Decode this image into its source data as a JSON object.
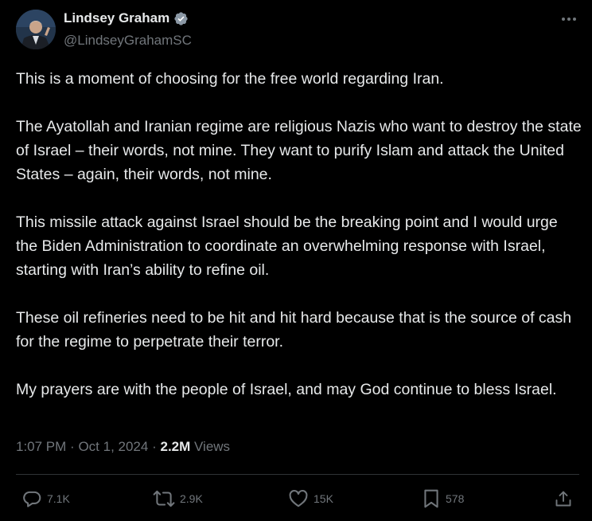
{
  "author": {
    "name": "Lindsey Graham",
    "handle": "@LindseyGrahamSC",
    "verified_icon": "verified-badge-icon",
    "badge_color": "#8b98a5"
  },
  "tweet": {
    "paragraphs": [
      "This is a moment of choosing for the free world regarding Iran.",
      "The Ayatollah and Iranian regime are religious Nazis who want to destroy the state of Israel – their words, not mine. They want to purify Islam and attack the United States – again, their words, not mine.",
      "This missile attack against Israel should be the breaking point and I would urge the Biden Administration to coordinate an overwhelming response with Israel, starting with Iran’s ability to refine oil.",
      "These oil refineries need to be hit and hit hard because that is the source of cash for the regime to perpetrate their terror.",
      "My prayers are with the people of Israel, and may God continue to bless Israel."
    ],
    "time": "1:07 PM",
    "separator": "·",
    "date": "Oct 1, 2024",
    "views_count": "2.2M",
    "views_label": "Views"
  },
  "actions": {
    "reply": {
      "icon": "reply-icon",
      "count": "7.1K"
    },
    "repost": {
      "icon": "repost-icon",
      "count": "2.9K"
    },
    "like": {
      "icon": "heart-icon",
      "count": "15K"
    },
    "bookmark": {
      "icon": "bookmark-icon",
      "count": "578"
    },
    "share": {
      "icon": "share-icon"
    }
  },
  "colors": {
    "background": "#000000",
    "text": "#e7e9ea",
    "muted": "#71767b",
    "divider": "#2f3336"
  }
}
